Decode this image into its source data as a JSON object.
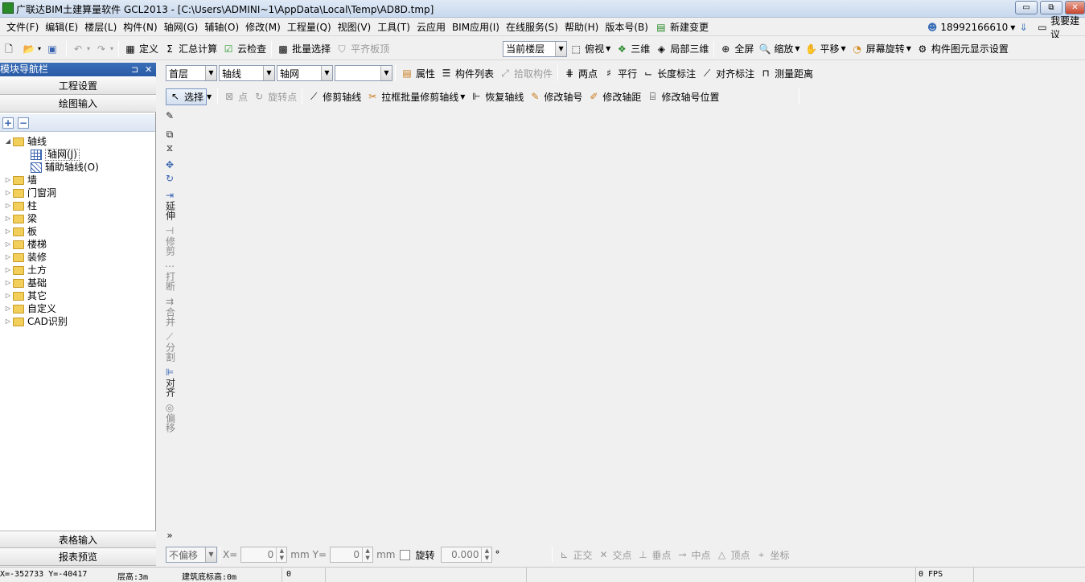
{
  "window": {
    "title": "广联达BIM土建算量软件 GCL2013 - [C:\\Users\\ADMINI~1\\AppData\\Local\\Temp\\AD8D.tmp]",
    "min": "▭",
    "max": "⧉",
    "close": "✕"
  },
  "menu": [
    "文件(F)",
    "编辑(E)",
    "楼层(L)",
    "构件(N)",
    "轴网(G)",
    "辅轴(O)",
    "修改(M)",
    "工程量(Q)",
    "视图(V)",
    "工具(T)",
    "云应用",
    "BIM应用(I)",
    "在线服务(S)",
    "帮助(H)",
    "版本号(B)",
    "新建变更"
  ],
  "account": {
    "phone": "18992166610",
    "suggest": "我要建议"
  },
  "toolbar1": {
    "define": "定义",
    "sum": "汇总计算",
    "cloudcheck": "云检查",
    "batchselect": "批量选择",
    "flatslab": "平齐板顶",
    "floor_combo": "当前楼层",
    "topview": "俯视",
    "threed": "三维",
    "local3d": "局部三维",
    "fullscreen": "全屏",
    "zoom": "缩放",
    "pan": "平移",
    "rotate": "屏幕旋转",
    "display": "构件图元显示设置"
  },
  "toolbar2": {
    "floor": "首层",
    "type": "轴线",
    "component": "轴网",
    "extra": "",
    "properties": "属性",
    "list": "构件列表",
    "pick": "拾取构件",
    "twopoint": "两点",
    "parallel": "平行",
    "length": "长度标注",
    "align": "对齐标注",
    "measure": "测量距离"
  },
  "toolbar3": {
    "select": "选择",
    "point": "点",
    "rotatepoint": "旋转点",
    "trim": "修剪轴线",
    "batchtrim": "拉框批量修剪轴线",
    "restore": "恢复轴线",
    "editnum": "修改轴号",
    "editdist": "修改轴距",
    "editpos": "修改轴号位置"
  },
  "nav": {
    "header": "模块导航栏",
    "pin": "⊐",
    "close": "✕",
    "project": "工程设置",
    "drawing": "绘图输入",
    "add": "+",
    "remove": "−",
    "table": "表格输入",
    "report": "报表预览",
    "tree": {
      "root": "轴线",
      "children": [
        "轴网(J)",
        "辅助轴线(O)"
      ],
      "folders": [
        "墙",
        "门窗洞",
        "柱",
        "梁",
        "板",
        "楼梯",
        "装修",
        "土方",
        "基础",
        "其它",
        "自定义",
        "CAD识别"
      ]
    }
  },
  "vtools": [
    "延伸",
    "修剪",
    "打断",
    "合并",
    "分割",
    "对齐",
    "偏移"
  ],
  "bottomtools": {
    "offset": "不偏移",
    "xlabel": "X=",
    "xval": "0",
    "unit": "mm",
    "ylabel": "Y=",
    "yval": "0",
    "rotate": "旋转",
    "rotval": "0.000",
    "deg": "°",
    "ortho": "正交",
    "intersect": "交点",
    "perp": "垂点",
    "mid": "中点",
    "vertex": "顶点",
    "coord": "坐标"
  },
  "status": {
    "coords": "X=-352733 Y=-40417",
    "floorheight": "层高:3m",
    "base": "建筑底标高:0m",
    "count": "0",
    "fps": "0 FPS"
  }
}
